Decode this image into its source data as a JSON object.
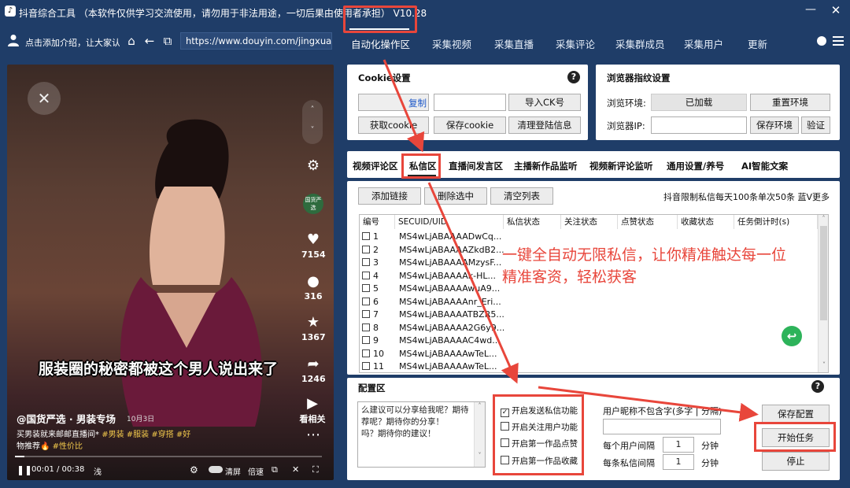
{
  "window": {
    "title": "抖音综合工具 （本软件仅供学习交流使用，请勿用于非法用途，一切后果由使用者承担） V10.28",
    "min_glyph": "—",
    "close_glyph": "✕",
    "logo_glyph": "♪"
  },
  "nav": {
    "intro": "点击添加介绍，让大家认",
    "url": "https://www.douyin.com/jingxuan",
    "icons": {
      "home": "⌂",
      "back": "←",
      "copy": "⧉"
    },
    "tabs": [
      "自动化操作区",
      "采集视频",
      "采集直播",
      "采集评论",
      "采集群成员",
      "采集用户",
      "更新"
    ],
    "active_tab": "自动化操作区"
  },
  "video": {
    "caption": "服装圈的秘密都被这个男人说出来了",
    "author": "@国货严选 · 男装专场",
    "date": "10月3日",
    "desc_line1": "买男装就来邮邮直播间*",
    "tags1": [
      "#男装",
      "#服装",
      "#穿搭",
      "#好"
    ],
    "desc_line2": "物推荐🔥",
    "tags2": [
      "#性价比"
    ],
    "avatar_text": "国货严选",
    "likes": "7154",
    "comments": "316",
    "favorites": "1367",
    "shares": "1246",
    "related": "看相关",
    "time": "00:01 / 00:38",
    "speed_label": "浅",
    "clear_label": "清屏",
    "rate_label": "倍速",
    "progress": 0.03
  },
  "cookie": {
    "title": "Cookie设置",
    "copy": "复制",
    "import_ck": "导入CK号",
    "get_cookie": "获取cookie",
    "save_cookie": "保存cookie",
    "clear_login": "清理登陆信息"
  },
  "browser": {
    "title": "浏览器指纹设置",
    "env_label": "浏览环境:",
    "env_status": "已加载",
    "reset_env": "重置环境",
    "ip_label": "浏览器IP:",
    "save_env": "保存环境",
    "verify": "验证"
  },
  "subtabs": [
    "视频评论区",
    "私信区",
    "直播间发言区",
    "主播新作品监听",
    "视频新评论监听",
    "通用设置/养号",
    "AI智能文案"
  ],
  "active_subtab": "私信区",
  "list": {
    "add_link": "添加链接",
    "delete_selected": "删除选中",
    "clear_list": "清空列表",
    "limit_note": "抖音限制私信每天100条单次50条 蓝V更多",
    "columns": [
      "编号",
      "SECUID/UID",
      "私信状态",
      "关注状态",
      "点赞状态",
      "收藏状态",
      "任务倒计时(s)"
    ],
    "rows": [
      {
        "id": "1",
        "uid": "MS4wLjABAAAADwCq..."
      },
      {
        "id": "2",
        "uid": "MS4wLjABAAAAZkdB2..."
      },
      {
        "id": "3",
        "uid": "MS4wLjABAAAAMzysF..."
      },
      {
        "id": "4",
        "uid": "MS4wLjABAAAAk-HL..."
      },
      {
        "id": "5",
        "uid": "MS4wLjABAAAAwuA9..."
      },
      {
        "id": "6",
        "uid": "MS4wLjABAAAAnr_Eri..."
      },
      {
        "id": "7",
        "uid": "MS4wLjABAAAATBZR5..."
      },
      {
        "id": "8",
        "uid": "MS4wLjABAAAA2G6y9..."
      },
      {
        "id": "9",
        "uid": "MS4wLjABAAAAC4wd..."
      },
      {
        "id": "10",
        "uid": "MS4wLjABAAAAwTeL..."
      },
      {
        "id": "11",
        "uid": "MS4wLjABAAAAwTeL..."
      }
    ]
  },
  "overlay": {
    "line1": "一键全自动无限私信，让你精准触达每一位",
    "line2": "精准客资，轻松获客",
    "color": "#e8463b"
  },
  "config": {
    "title": "配置区",
    "messages": "么建议可以分享给我呢？期待\n荐呢？期待你的分享！\n吗？期待你的建议！",
    "options": [
      {
        "label": "开启发送私信功能",
        "checked": true
      },
      {
        "label": "开启关注用户功能",
        "checked": false
      },
      {
        "label": "开启第一作品点赞",
        "checked": false
      },
      {
        "label": "开启第一作品收藏",
        "checked": false
      }
    ],
    "nickname_label": "用户昵称不包含字(多字 | 分隔)",
    "user_interval_label": "每个用户间隔",
    "user_interval_value": "1",
    "dm_interval_label": "每条私信间隔",
    "dm_interval_value": "1",
    "minute_unit": "分钟",
    "save_config": "保存配置",
    "start_task": "开始任务",
    "stop": "停止"
  },
  "help_glyph": "?",
  "accent": "#e8463b"
}
